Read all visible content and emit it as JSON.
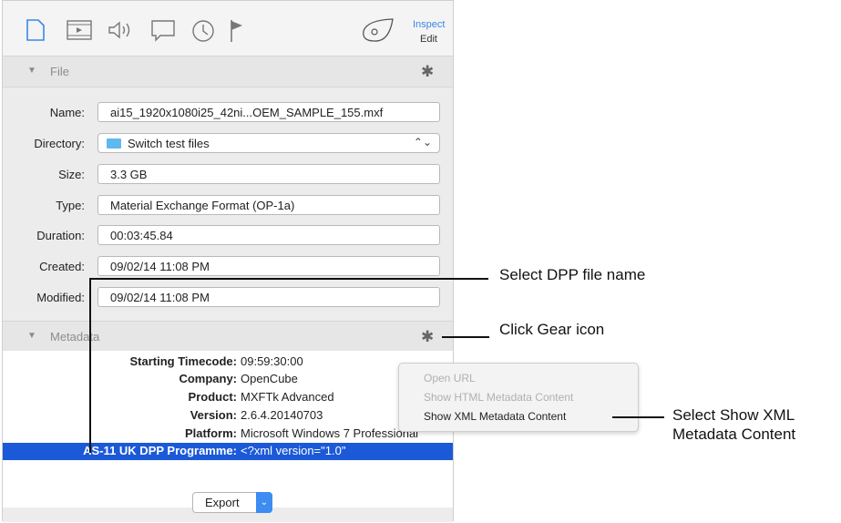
{
  "toolbar": {
    "inspect_label": "Inspect",
    "edit_label": "Edit"
  },
  "file_section": {
    "title": "File"
  },
  "fields": {
    "name": {
      "label": "Name:",
      "value": "ai15_1920x1080i25_42ni...OEM_SAMPLE_155.mxf"
    },
    "directory": {
      "label": "Directory:",
      "value": "Switch test files"
    },
    "size": {
      "label": "Size:",
      "value": "3.3 GB"
    },
    "type": {
      "label": "Type:",
      "value": "Material Exchange Format (OP-1a)"
    },
    "duration": {
      "label": "Duration:",
      "value": "00:03:45.84"
    },
    "created": {
      "label": "Created:",
      "value": "09/02/14 11:08 PM"
    },
    "modified": {
      "label": "Modified:",
      "value": "09/02/14 11:08 PM"
    }
  },
  "metadata_section": {
    "title": "Metadata"
  },
  "metadata_rows": [
    {
      "key": "Starting Timecode:",
      "value": "09:59:30:00"
    },
    {
      "key": "Company:",
      "value": "OpenCube"
    },
    {
      "key": "Product:",
      "value": "MXFTk Advanced"
    },
    {
      "key": "Version:",
      "value": "2.6.4.20140703"
    },
    {
      "key": "Platform:",
      "value": "Microsoft Windows 7 Professional"
    },
    {
      "key": "AS-11 UK DPP Programme:",
      "value": "<?xml version=\"1.0\""
    }
  ],
  "context_menu": {
    "items": [
      "Open URL",
      "Show HTML Metadata Content",
      "Show XML Metadata Content"
    ]
  },
  "export_button": {
    "label": "Export"
  },
  "callouts": {
    "select_dpp": "Select DPP file name",
    "click_gear": "Click Gear icon",
    "select_xml_1": "Select Show XML",
    "select_xml_2": "Metadata Content"
  },
  "colors": {
    "selection": "#1b59d8",
    "accent": "#3d86e6",
    "folder": "#5fb8ee"
  }
}
